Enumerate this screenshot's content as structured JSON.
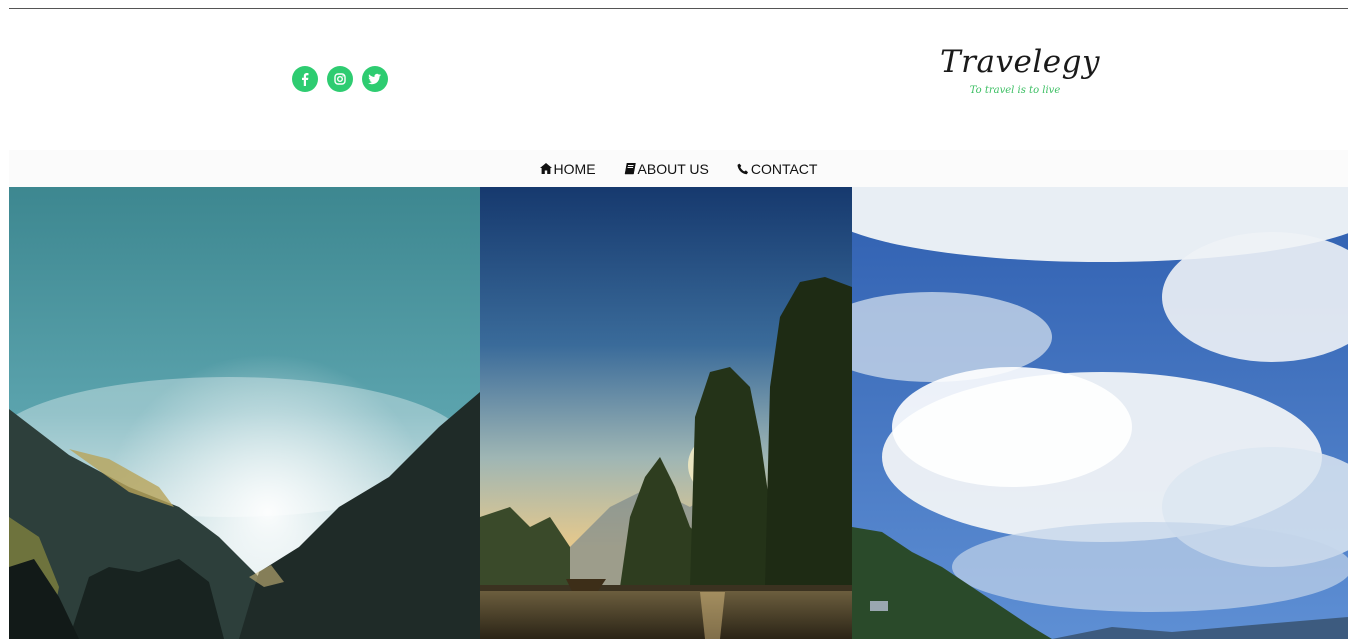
{
  "social": [
    {
      "name": "facebook",
      "icon": "facebook-icon",
      "glyph": "f"
    },
    {
      "name": "instagram",
      "icon": "instagram-icon"
    },
    {
      "name": "twitter",
      "icon": "twitter-icon"
    }
  ],
  "colors": {
    "accent": "#2ecc71",
    "brand_text": "#1a1a1a",
    "tagline": "#3cbf63"
  },
  "brand": {
    "name": "Travelegy",
    "tagline": "To travel is to live"
  },
  "nav": [
    {
      "label": "HOME",
      "icon": "home-icon"
    },
    {
      "label": "ABOUT US",
      "icon": "book-icon"
    },
    {
      "label": "CONTACT",
      "icon": "phone-icon"
    }
  ],
  "gallery": [
    {
      "scene": "mountain-valley-photo"
    },
    {
      "scene": "lake-sunset-photo"
    },
    {
      "scene": "cloudy-sky-photo"
    }
  ]
}
